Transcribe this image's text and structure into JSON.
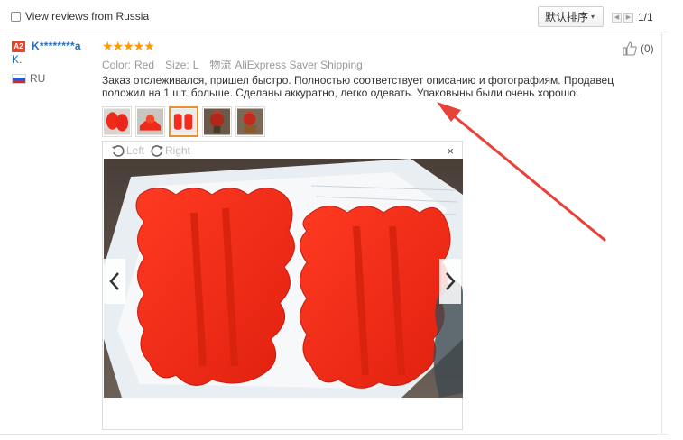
{
  "filter": {
    "label": "View reviews from Russia"
  },
  "sort": {
    "label": "默认排序"
  },
  "pager": {
    "page_text": "1/1"
  },
  "review": {
    "avatar_text": "A2",
    "user_name": "K********a",
    "user_name_cont": "K.",
    "country": "RU",
    "rating_stars": 5,
    "stars_text": "★★★★★",
    "color_label": "Color:",
    "color_value": "Red",
    "size_label": "Size:",
    "size_value": "L",
    "shipping_label": "物流",
    "shipping_value": "AliExpress Saver Shipping",
    "text": "Заказ отслеживался, пришел быстро. Полностью соответствует описанию и фотографиям. Продавец положил на 1 шт. больше. Сделаны аккуратно, легко одевать. Упаковыны были очень хорошо.",
    "helpful_count": "(0)"
  },
  "viewer": {
    "rotate_left": "Left",
    "rotate_right": "Right",
    "close": "×",
    "thumbnails": [
      "thumb-red-items-1",
      "thumb-red-items-2",
      "thumb-red-items-3",
      "thumb-rooster-1",
      "thumb-rooster-2"
    ],
    "selected_thumb_index": 2
  },
  "colors": {
    "link": "#2a6ebb",
    "star": "#ff9a00",
    "annotation_arrow": "#e8413a",
    "item_red": "#f5291b"
  }
}
